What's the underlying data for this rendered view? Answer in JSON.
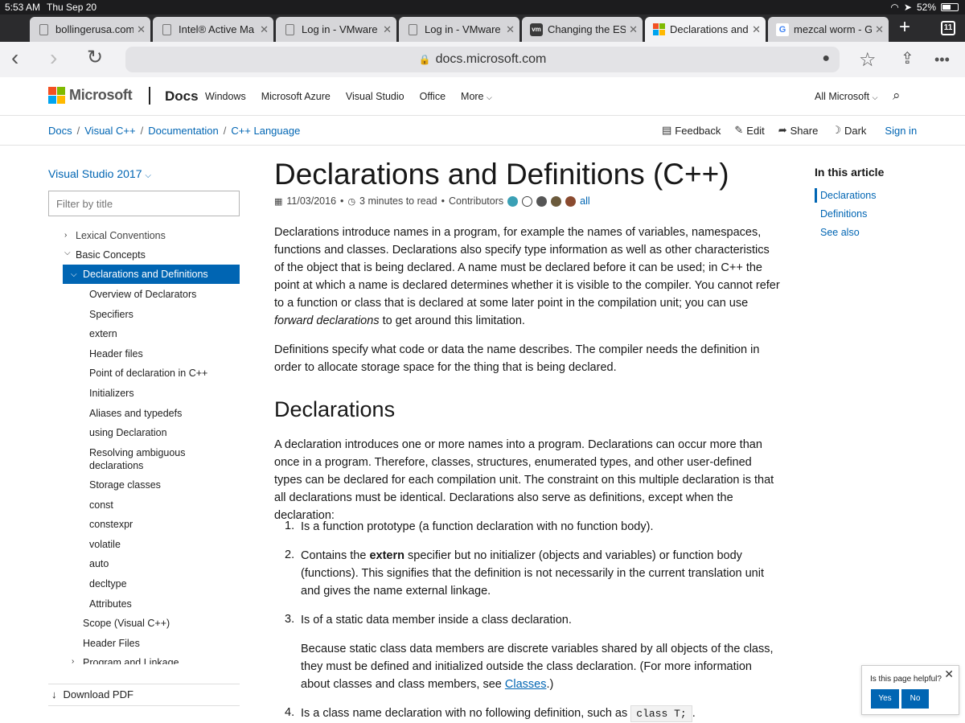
{
  "status_bar": {
    "time": "5:53 AM",
    "date": "Thu Sep 20",
    "battery": "52%"
  },
  "tabs": [
    {
      "title": "bollingerusa.com",
      "icon": "page-icon"
    },
    {
      "title": "Intel® Active Ma",
      "icon": "page-icon"
    },
    {
      "title": "Log in - VMware",
      "icon": "page-icon"
    },
    {
      "title": "Log in - VMware",
      "icon": "page-icon"
    },
    {
      "title": "Changing the ES",
      "icon": "vm-icon"
    },
    {
      "title": "Declarations and",
      "icon": "microsoft-icon"
    },
    {
      "title": "mezcal worm - G",
      "icon": "google-icon"
    }
  ],
  "tab_count": "11",
  "vm_icon_text": "vm",
  "google_icon_text": "G",
  "address": "docs.microsoft.com",
  "header": {
    "logo_text": "Microsoft",
    "brand": "Docs",
    "nav": [
      "Windows",
      "Microsoft Azure",
      "Visual Studio",
      "Office",
      "More"
    ],
    "all_microsoft": "All Microsoft"
  },
  "breadcrumb": [
    "Docs",
    "Visual C++",
    "Documentation",
    "C++ Language"
  ],
  "actions": {
    "feedback": "Feedback",
    "edit": "Edit",
    "share": "Share",
    "dark": "Dark",
    "signin": "Sign in"
  },
  "leftnav": {
    "version": "Visual Studio 2017",
    "filter_placeholder": "Filter by title",
    "items": [
      "Lexical Conventions",
      "Basic Concepts",
      "Declarations and Definitions",
      "Overview of Declarators",
      "Specifiers",
      "extern",
      "Header files",
      "Point of declaration in C++",
      "Initializers",
      "Aliases and typedefs",
      "using Declaration",
      "Resolving ambiguous declarations",
      "Storage classes",
      "const",
      "constexpr",
      "volatile",
      "auto",
      "decltype",
      "Attributes",
      "Scope (Visual C++)",
      "Header Files",
      "Program and Linkage"
    ],
    "download": "Download PDF"
  },
  "article": {
    "title": "Declarations and Definitions (C++)",
    "date": "11/03/2016",
    "read_time": "3 minutes to read",
    "contributors": "Contributors",
    "all": "all",
    "p1_a": "Declarations introduce names in a program, for example the names of variables, namespaces, functions and classes. Declarations also specify type information as well as other characteristics of the object that is being declared. A name must be declared before it can be used; in C++ the point at which a name is declared determines whether it is visible to the compiler. You cannot refer to a function or class that is declared at some later point in the compilation unit; you can use",
    "p1_em": "forward declarations",
    "p1_b": "to get around this limitation.",
    "p2": "Definitions specify what code or data the name describes. The compiler needs the definition in order to allocate storage space for the thing that is being declared.",
    "h2": "Declarations",
    "p3": "A declaration introduces one or more names into a program. Declarations can occur more than once in a program. Therefore, classes, structures, enumerated types, and other user-defined types can be declared for each compilation unit. The constraint on this multiple declaration is that all declarations must be identical. Declarations also serve as definitions, except when the declaration:",
    "list": {
      "n1": "1.",
      "i1": "Is a function prototype (a function declaration with no function body).",
      "n2": "2.",
      "i2_a": "Contains the",
      "i2_bold": "extern",
      "i2_b": "specifier but no initializer (objects and variables) or function body (functions). This signifies that the definition is not necessarily in the current translation unit and gives the name external linkage.",
      "n3": "3.",
      "i3": "Is of a static data member inside a class declaration.",
      "i3_note_a": "Because static class data members are discrete variables shared by all objects of the class, they must be defined and initialized outside the class declaration. (For more information about classes and class members, see",
      "i3_note_link": "Classes",
      "i3_note_b": ".)",
      "n4": "4.",
      "i4_a": "Is a class name declaration with no following definition, such as",
      "i4_code": "class T;",
      "i4_b": "."
    }
  },
  "rtoc": {
    "heading": "In this article",
    "items": [
      "Declarations",
      "Definitions",
      "See also"
    ]
  },
  "feedback": {
    "question": "Is this page helpful?",
    "yes": "Yes",
    "no": "No"
  },
  "colors": {
    "accent": "#0065b3",
    "ms_red": "#f25022",
    "ms_green": "#7fba00",
    "ms_blue": "#00a4ef",
    "ms_yellow": "#ffb900"
  }
}
